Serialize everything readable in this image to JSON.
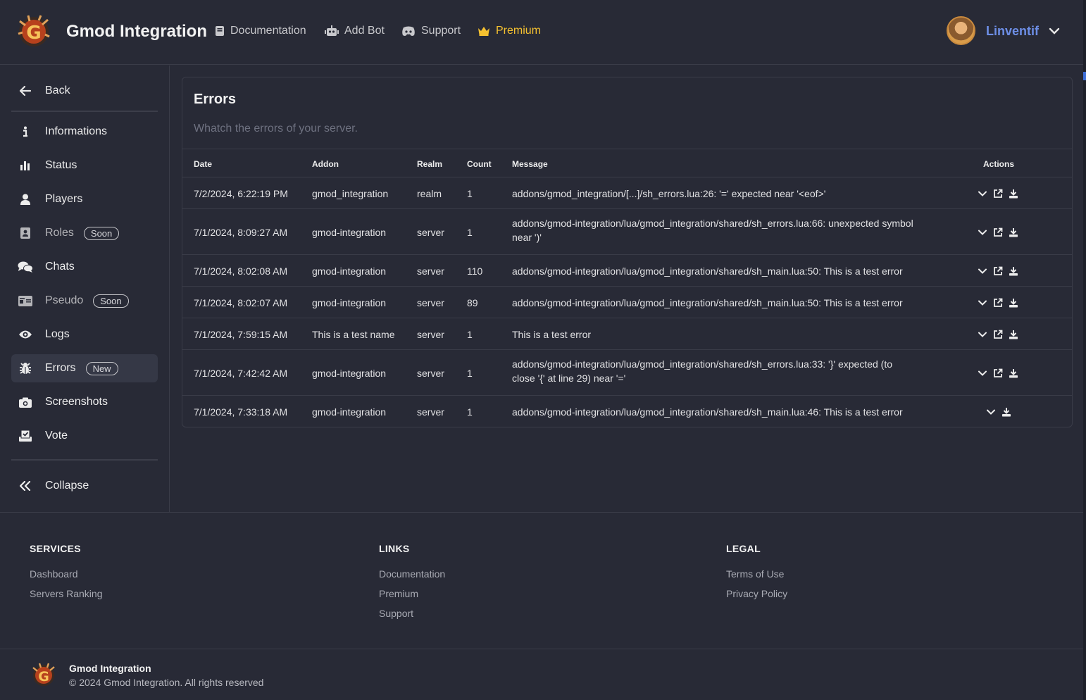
{
  "header": {
    "brand": "Gmod Integration",
    "nav": [
      {
        "label": "Documentation",
        "icon": "book-icon"
      },
      {
        "label": "Add Bot",
        "icon": "robot-icon"
      },
      {
        "label": "Support",
        "icon": "discord-icon"
      },
      {
        "label": "Premium",
        "icon": "crown-icon"
      }
    ],
    "username": "Linventif"
  },
  "sidebar": {
    "back": "Back",
    "items": [
      {
        "label": "Informations",
        "icon": "info-icon"
      },
      {
        "label": "Status",
        "icon": "bar-chart-icon"
      },
      {
        "label": "Players",
        "icon": "user-icon"
      },
      {
        "label": "Roles",
        "icon": "id-badge-icon",
        "badge": "Soon"
      },
      {
        "label": "Chats",
        "icon": "chat-bubbles-icon"
      },
      {
        "label": "Pseudo",
        "icon": "id-card-icon",
        "badge": "Soon"
      },
      {
        "label": "Logs",
        "icon": "eye-icon"
      },
      {
        "label": "Errors",
        "icon": "bug-icon",
        "badge": "New"
      },
      {
        "label": "Screenshots",
        "icon": "camera-icon"
      },
      {
        "label": "Vote",
        "icon": "ballot-icon"
      }
    ],
    "collapse": "Collapse"
  },
  "errors": {
    "title": "Errors",
    "subtitle": "Whatch the errors of your server.",
    "columns": {
      "date": "Date",
      "addon": "Addon",
      "realm": "Realm",
      "count": "Count",
      "message": "Message",
      "actions": "Actions"
    },
    "rows": [
      {
        "date": "7/2/2024, 6:22:19 PM",
        "addon": "gmod_integration",
        "realm": "realm",
        "count": "1",
        "message": "addons/gmod_integration/[...]/sh_errors.lua:26: '=' expected near '<eof>'",
        "actions": [
          "expand",
          "open",
          "download"
        ]
      },
      {
        "date": "7/1/2024, 8:09:27 AM",
        "addon": "gmod-integration",
        "realm": "server",
        "count": "1",
        "message": "addons/gmod-integration/lua/gmod_integration/shared/sh_errors.lua:66: unexpected symbol near ')'",
        "actions": [
          "expand",
          "open",
          "download"
        ]
      },
      {
        "date": "7/1/2024, 8:02:08 AM",
        "addon": "gmod-integration",
        "realm": "server",
        "count": "110",
        "message": "addons/gmod-integration/lua/gmod_integration/shared/sh_main.lua:50: This is a test error",
        "actions": [
          "expand",
          "open",
          "download"
        ]
      },
      {
        "date": "7/1/2024, 8:02:07 AM",
        "addon": "gmod-integration",
        "realm": "server",
        "count": "89",
        "message": "addons/gmod-integration/lua/gmod_integration/shared/sh_main.lua:50: This is a test error",
        "actions": [
          "expand",
          "open",
          "download"
        ]
      },
      {
        "date": "7/1/2024, 7:59:15 AM",
        "addon": "This is a test name",
        "realm": "server",
        "count": "1",
        "message": "This is a test error",
        "actions": [
          "expand",
          "open",
          "download"
        ]
      },
      {
        "date": "7/1/2024, 7:42:42 AM",
        "addon": "gmod-integration",
        "realm": "server",
        "count": "1",
        "message": "addons/gmod-integration/lua/gmod_integration/shared/sh_errors.lua:33: '}' expected (to close '{' at line 29) near '='",
        "actions": [
          "expand",
          "open",
          "download"
        ]
      },
      {
        "date": "7/1/2024, 7:33:18 AM",
        "addon": "gmod-integration",
        "realm": "server",
        "count": "1",
        "message": "addons/gmod-integration/lua/gmod_integration/shared/sh_main.lua:46: This is a test error",
        "actions": [
          "expand",
          "download"
        ]
      }
    ]
  },
  "footer": {
    "services": {
      "title": "SERVICES",
      "links": [
        "Dashboard",
        "Servers Ranking"
      ]
    },
    "links": {
      "title": "LINKS",
      "links": [
        "Documentation",
        "Premium",
        "Support"
      ]
    },
    "legal": {
      "title": "LEGAL",
      "links": [
        "Terms of Use",
        "Privacy Policy"
      ]
    },
    "brand": "Gmod Integration",
    "copyright": "© 2024 Gmod Integration. All rights reserved"
  },
  "colors": {
    "background": "#282a36",
    "accent_user": "#6d8ee6",
    "premium": "#f5c130",
    "border": "#3a3c48"
  }
}
